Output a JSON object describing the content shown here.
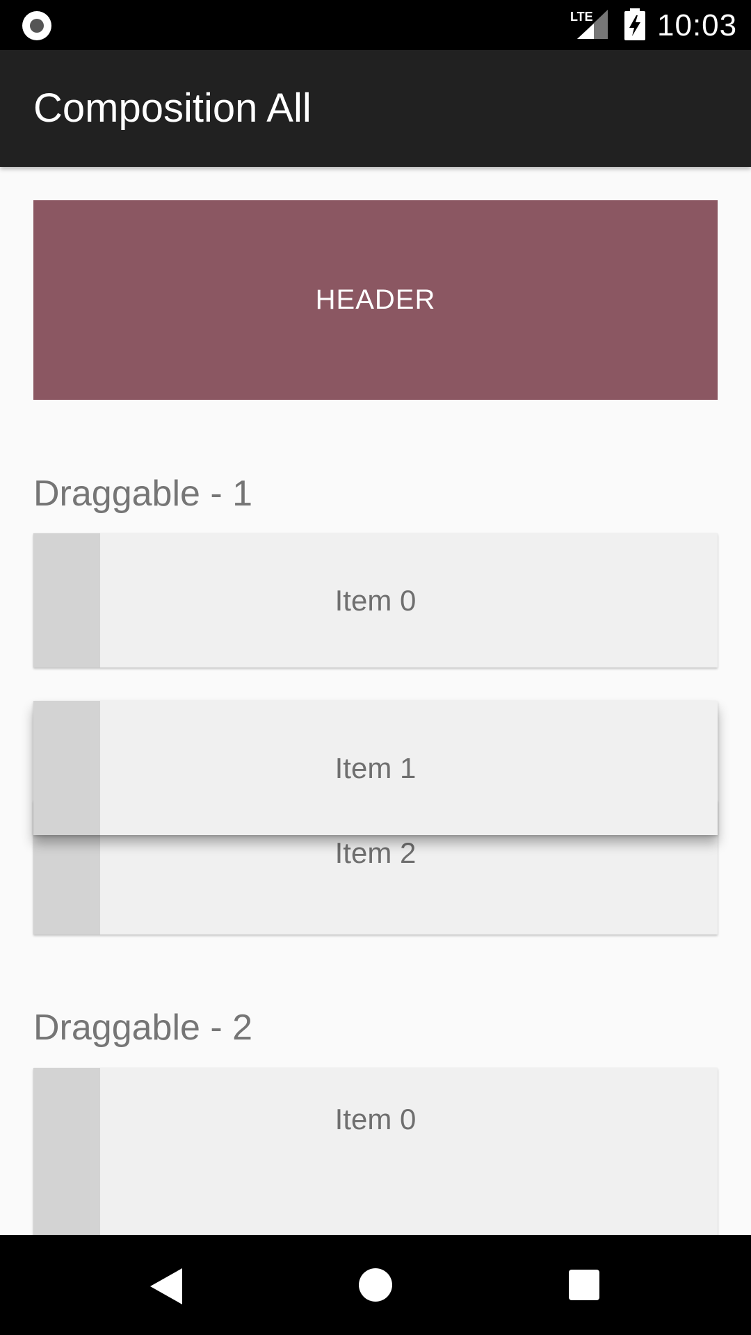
{
  "status_bar": {
    "time": "10:03",
    "network_label": "LTE",
    "icons": [
      "record-icon",
      "lte-signal-icon",
      "battery-charging-icon"
    ]
  },
  "app_bar": {
    "title": "Composition All"
  },
  "header": {
    "label": "HEADER",
    "color": "#8b5762"
  },
  "sections": [
    {
      "title": "Draggable - 1",
      "items": [
        "Item 0",
        "Item 1",
        "Item 2"
      ]
    },
    {
      "title": "Draggable - 2",
      "items": [
        "Item 0"
      ]
    }
  ],
  "nav_bar": {
    "icons": [
      "back-icon",
      "home-icon",
      "recents-icon"
    ]
  }
}
